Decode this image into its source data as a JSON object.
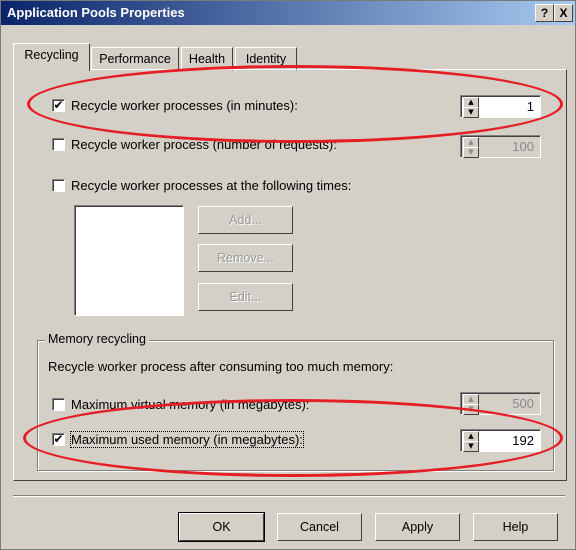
{
  "window": {
    "title": "Application Pools Properties",
    "help_label": "?",
    "close_label": "X"
  },
  "tabs": [
    {
      "label": "Recycling"
    },
    {
      "label": "Performance"
    },
    {
      "label": "Health"
    },
    {
      "label": "Identity"
    }
  ],
  "recycling": {
    "minutes": {
      "checked": true,
      "label": "Recycle worker processes (in minutes):",
      "value": "1"
    },
    "requests": {
      "checked": false,
      "label": "Recycle worker process (number of requests):",
      "value": "100"
    },
    "times": {
      "checked": false,
      "label": "Recycle worker processes at the following times:"
    },
    "add_label": "Add...",
    "remove_label": "Remove...",
    "edit_label": "Edit..."
  },
  "memory": {
    "group_title": "Memory recycling",
    "description": "Recycle worker process after consuming too much memory:",
    "virtual": {
      "checked": false,
      "label": "Maximum virtual memory (in megabytes):",
      "value": "500"
    },
    "used": {
      "checked": true,
      "label": "Maximum used memory (in megabytes):",
      "value": "192"
    }
  },
  "footer": {
    "ok_label": "OK",
    "cancel_label": "Cancel",
    "apply_label": "Apply",
    "help_label": "Help"
  },
  "annotation_color": "#e51e25",
  "check_glyph": "✔"
}
